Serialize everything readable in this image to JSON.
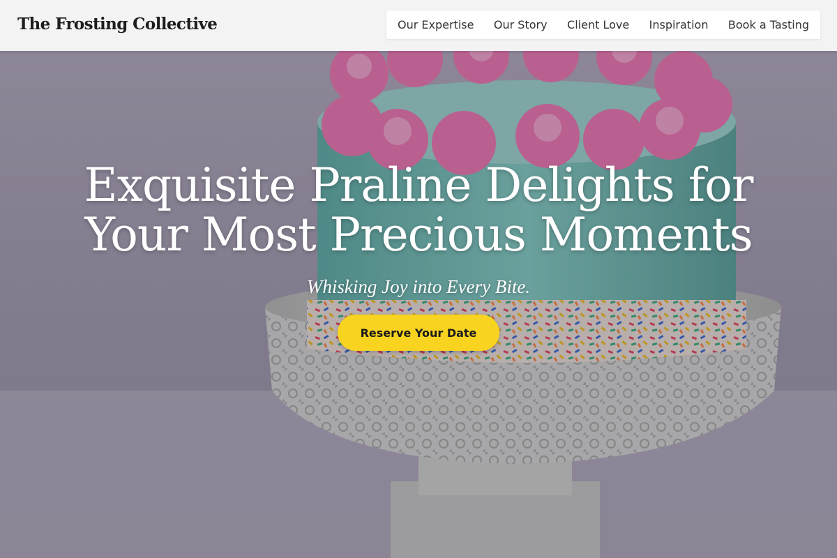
{
  "header": {
    "brand": "The Frosting Collective"
  },
  "nav": {
    "items": [
      {
        "label": "Our Expertise"
      },
      {
        "label": "Our Story"
      },
      {
        "label": "Client Love"
      },
      {
        "label": "Inspiration"
      },
      {
        "label": "Book a Tasting"
      }
    ]
  },
  "hero": {
    "title": "Exquisite Praline Delights for Your Most Precious Moments",
    "tagline": "Whisking Joy into Every Bite.",
    "cta_label": "Reserve Your Date",
    "background": "cake-photo"
  },
  "colors": {
    "cta": "#f8d320",
    "header_bg": "#f3f3f3",
    "frosting_pink": "#f27bb5",
    "cake_teal": "#7fcfc1"
  }
}
